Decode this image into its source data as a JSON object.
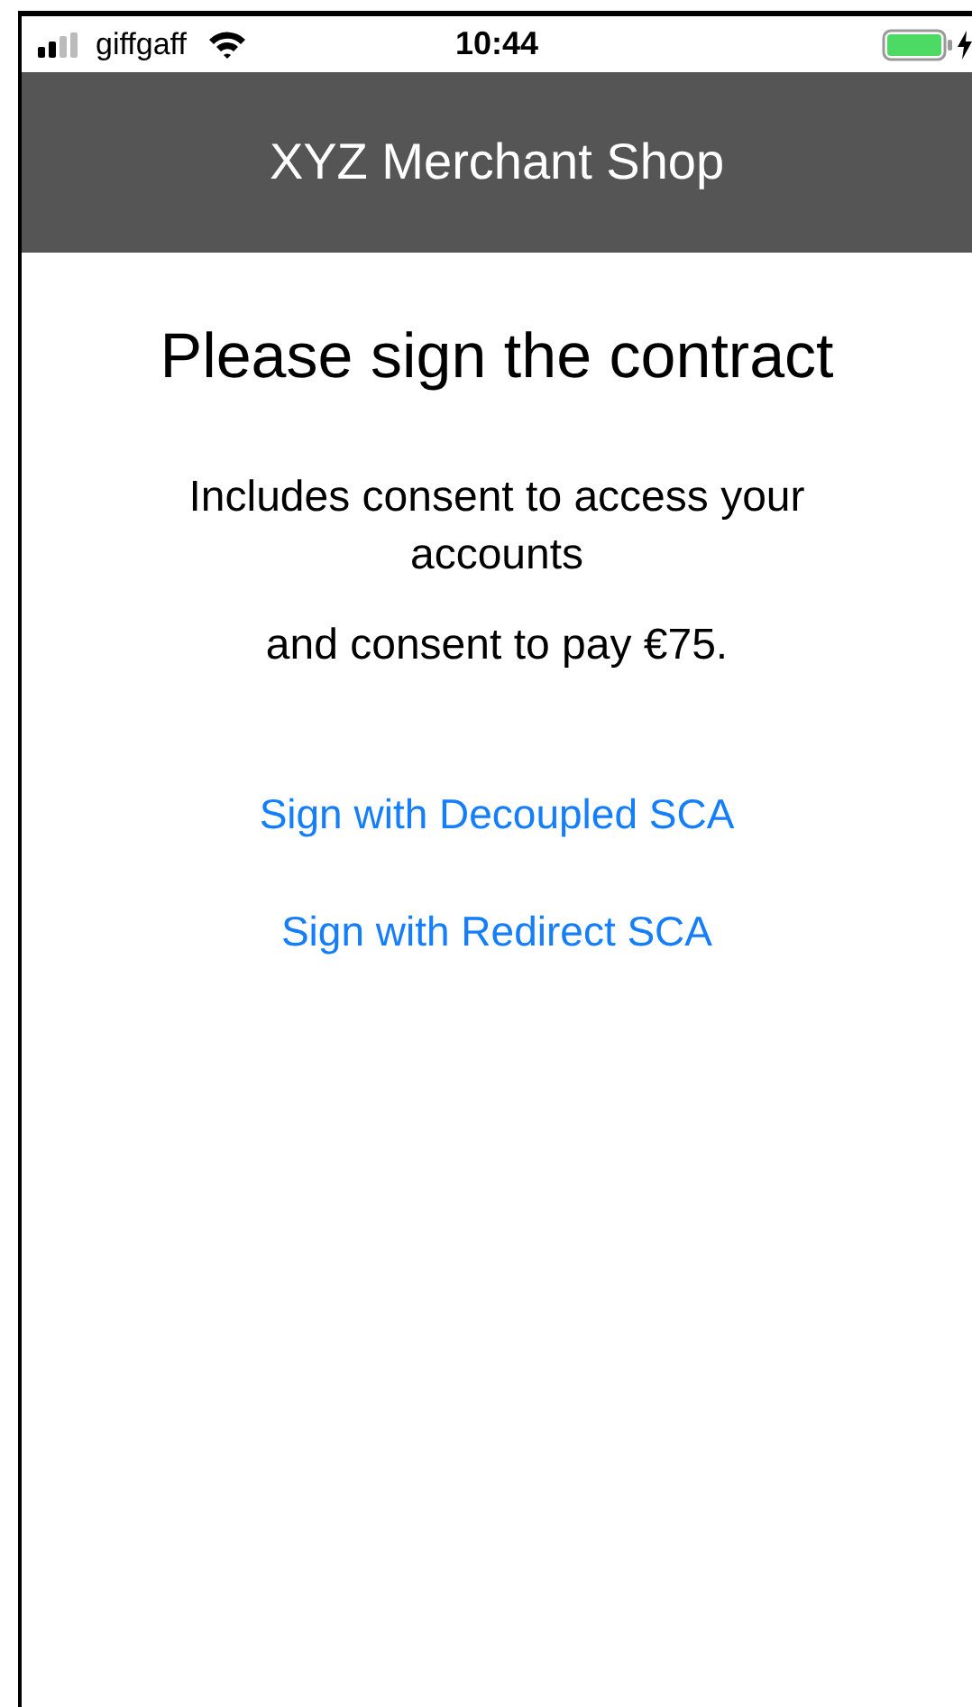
{
  "status_bar": {
    "carrier": "giffgaff",
    "time": "10:44"
  },
  "header": {
    "title": "XYZ Merchant Shop"
  },
  "content": {
    "heading": "Please sign the contract",
    "paragraphs": [
      "Includes consent to access your accounts",
      "and consent to pay €75."
    ],
    "links": [
      "Sign with Decoupled SCA",
      "Sign with Redirect SCA"
    ]
  }
}
